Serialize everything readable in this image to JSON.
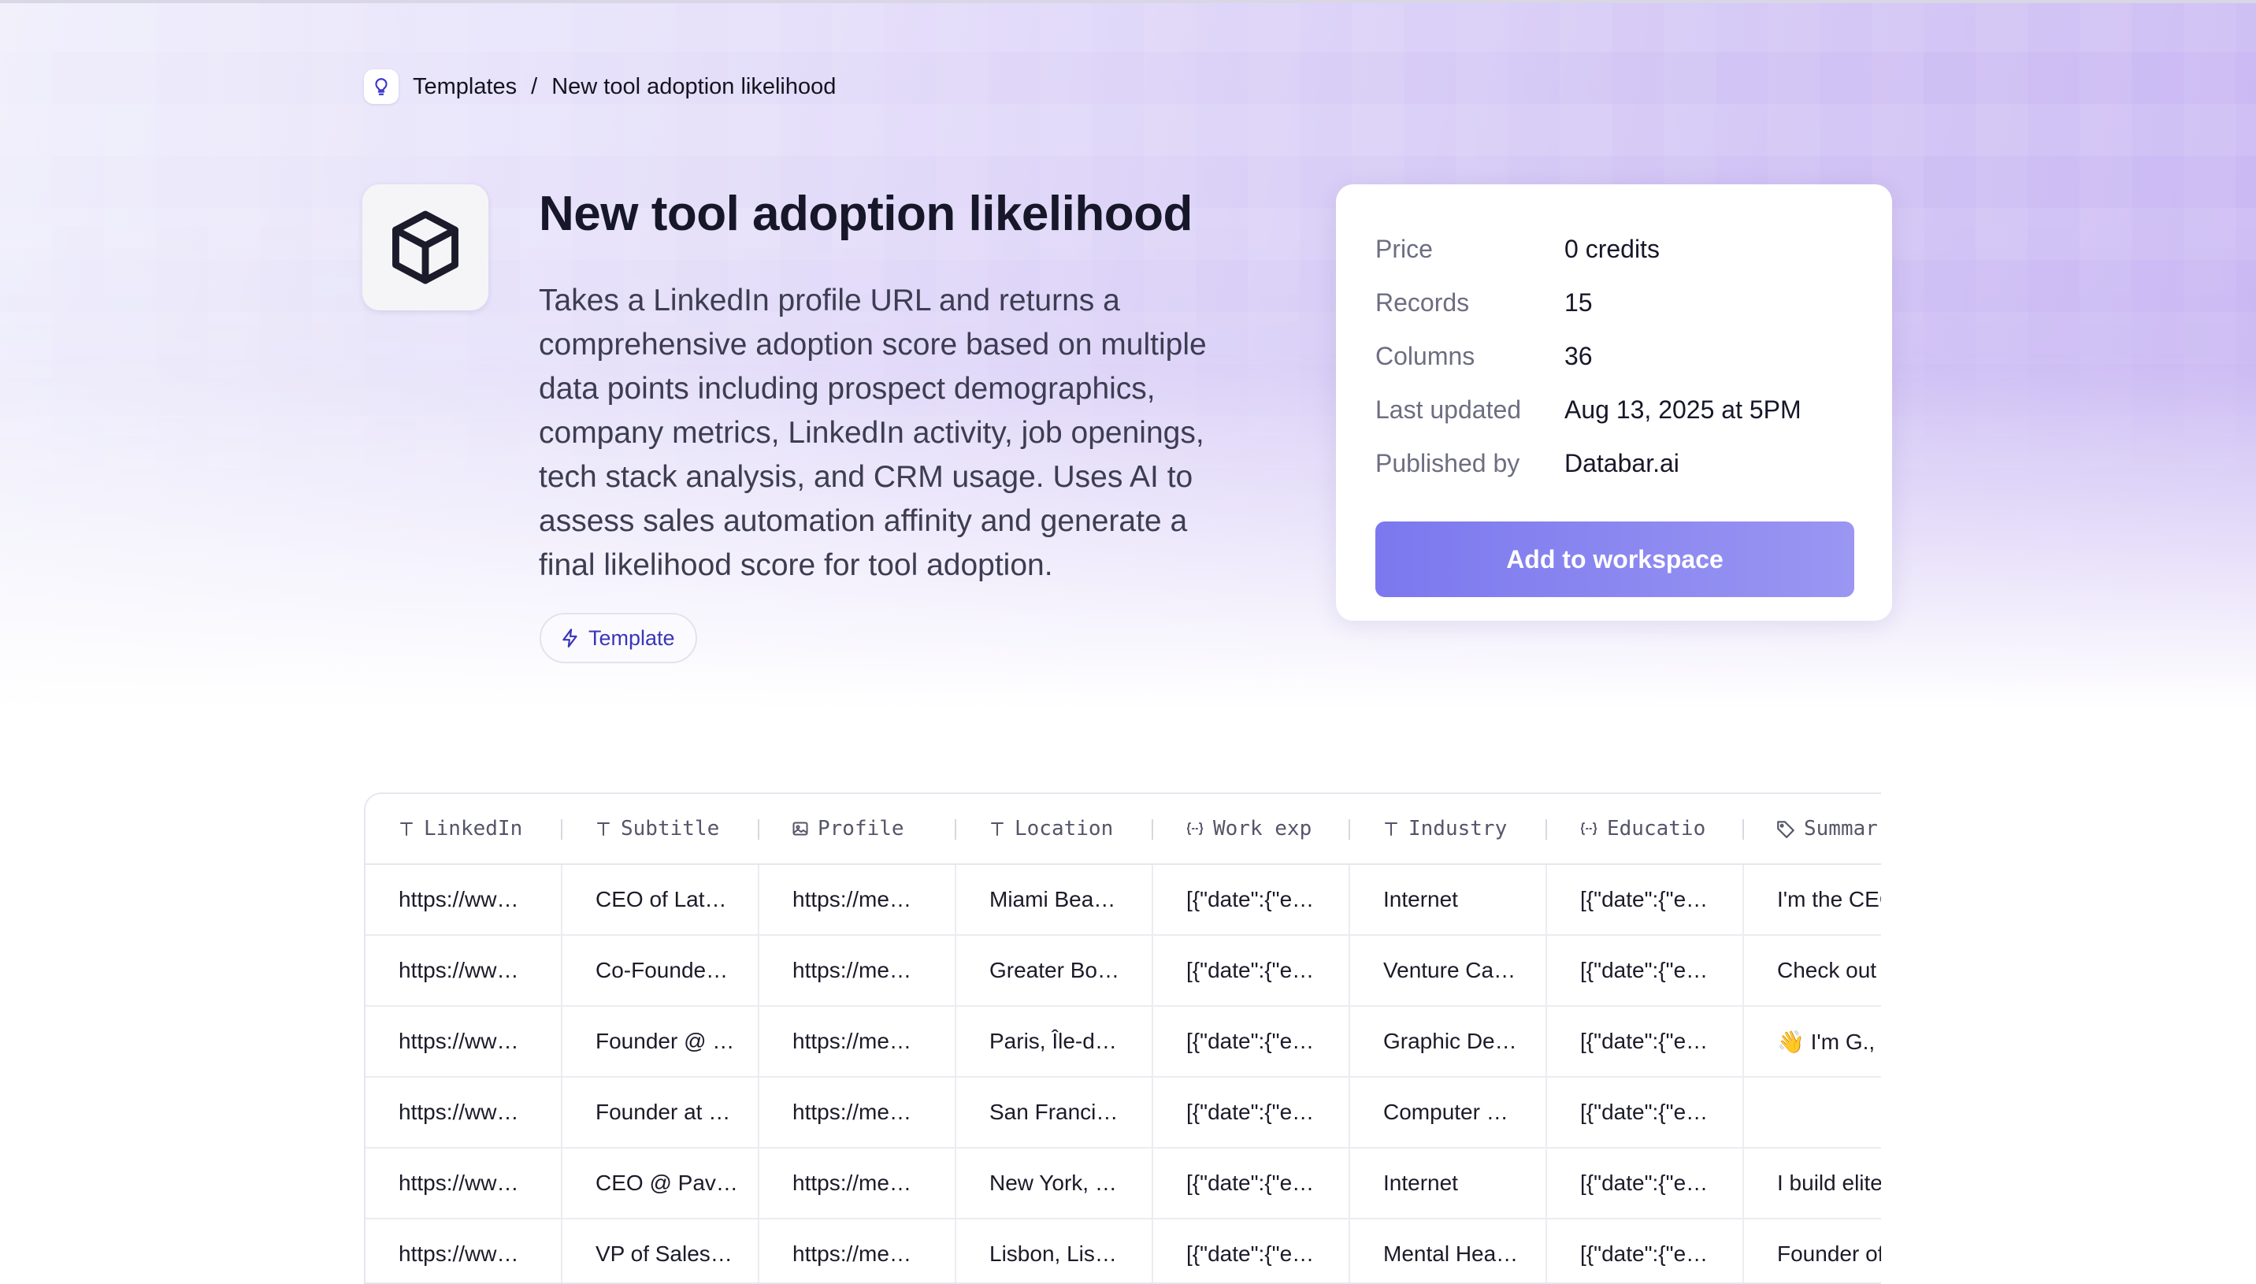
{
  "breadcrumb": {
    "parent": "Templates",
    "separator": "/",
    "current": "New tool adoption likelihood"
  },
  "header": {
    "title": "New tool adoption likelihood",
    "description": "Takes a LinkedIn profile URL and returns a comprehensive adoption score based on multiple data points including prospect demographics, company metrics, LinkedIn activity, job openings, tech stack analysis, and CRM usage. Uses AI to assess sales automation affinity and generate a final likelihood score for tool adoption.",
    "tag": "Template"
  },
  "info_card": {
    "rows": [
      {
        "label": "Price",
        "value": "0 credits"
      },
      {
        "label": "Records",
        "value": "15"
      },
      {
        "label": "Columns",
        "value": "36"
      },
      {
        "label": "Last updated",
        "value": "Aug 13, 2025 at 5PM"
      },
      {
        "label": "Published by",
        "value": "Databar.ai"
      }
    ],
    "button_label": "Add to workspace"
  },
  "table": {
    "columns": [
      {
        "label": "LinkedIn",
        "icon": "text-icon"
      },
      {
        "label": "Subtitle",
        "icon": "text-icon"
      },
      {
        "label": "Profile",
        "icon": "image-icon"
      },
      {
        "label": "Location",
        "icon": "text-icon"
      },
      {
        "label": "Work exp",
        "icon": "json-icon"
      },
      {
        "label": "Industry",
        "icon": "text-icon"
      },
      {
        "label": "Educatio",
        "icon": "json-icon"
      },
      {
        "label": "Summar",
        "icon": "tag-icon"
      }
    ],
    "rows": [
      [
        "https://ww…",
        "CEO of Lat…",
        "https://me…",
        "Miami Bea…",
        "[{\"date\":{\"e…",
        "Internet",
        "[{\"date\":{\"e…",
        "I'm the CEO"
      ],
      [
        "https://ww…",
        "Co-Founde…",
        "https://me…",
        "Greater Bo…",
        "[{\"date\":{\"e…",
        "Venture Ca…",
        "[{\"date\":{\"e…",
        "Check out"
      ],
      [
        "https://ww…",
        "Founder @ …",
        "https://me…",
        "Paris, Île-d…",
        "[{\"date\":{\"e…",
        "Graphic De…",
        "[{\"date\":{\"e…",
        "👋 I'm G.,"
      ],
      [
        "https://ww…",
        "Founder at …",
        "https://me…",
        "San Franci…",
        "[{\"date\":{\"e…",
        "Computer …",
        "[{\"date\":{\"e…",
        ""
      ],
      [
        "https://ww…",
        "CEO @ Pav…",
        "https://me…",
        "New York, …",
        "[{\"date\":{\"e…",
        "Internet",
        "[{\"date\":{\"e…",
        "I build elite"
      ],
      [
        "https://ww…",
        "VP of Sales…",
        "https://me…",
        "Lisbon, Lis…",
        "[{\"date\":{\"e…",
        "Mental Hea…",
        "[{\"date\":{\"e…",
        "Founder of"
      ]
    ]
  }
}
